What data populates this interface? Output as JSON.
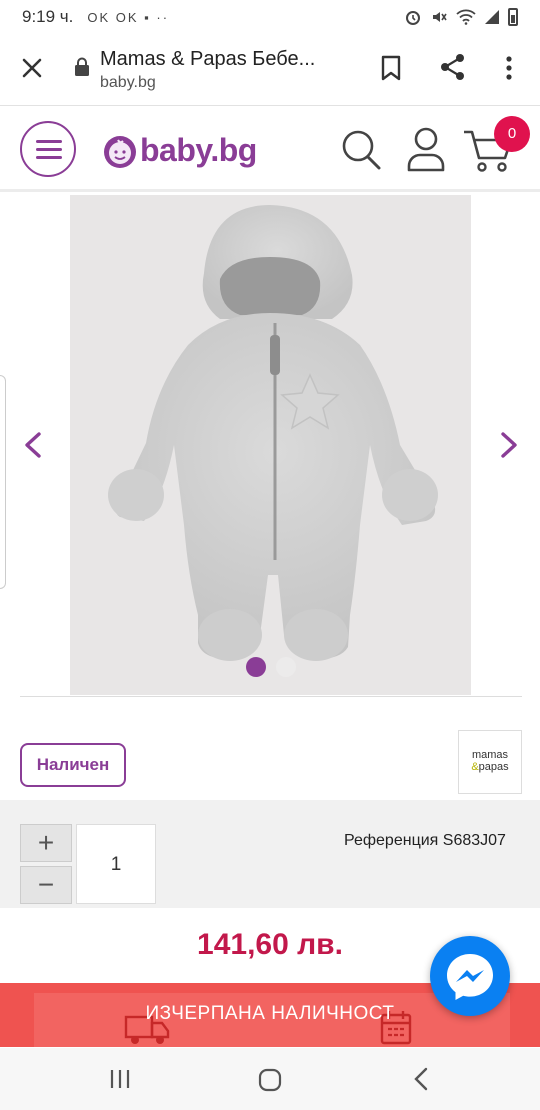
{
  "status_bar": {
    "time": "9:19 ч.",
    "notification_icons": "OK OK ▪ ··",
    "right_icons": [
      "alarm-icon",
      "mute-icon",
      "wifi-icon",
      "signal-icon",
      "battery-icon"
    ]
  },
  "browser": {
    "page_title": "Mamas & Papas Бебе...",
    "url": "baby.bg",
    "icons": [
      "close-icon",
      "lock-icon",
      "bookmark-icon",
      "share-icon",
      "more-vert-icon"
    ]
  },
  "site_header": {
    "logo_text": "baby.bg",
    "cart_count": "0",
    "brand_color": "#8a3d96",
    "badge_color": "#e0124e"
  },
  "gallery": {
    "image_description": "product-photo-grey-fleece-pramsuit",
    "dots": 2,
    "active_dot": 1
  },
  "product": {
    "availability": "Наличен",
    "brand_logo_line1": "mamas",
    "brand_logo_amp": "&",
    "brand_logo_line2": "papas",
    "quantity": "1",
    "plus_label": "+",
    "minus_label": "−",
    "reference": "Референция S683J07",
    "price": "141,60 лв.",
    "price_color": "#c2184b"
  },
  "sold_out_bar": {
    "label": "ИЗЧЕРПАНА НАЛИЧНОСТ",
    "color": "#ef5350"
  },
  "system_nav": {
    "buttons": [
      "recent-apps-icon",
      "home-icon",
      "back-icon"
    ]
  }
}
